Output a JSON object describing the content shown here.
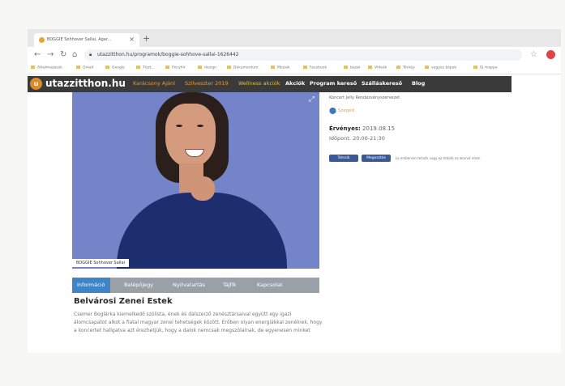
{
  "browser": {
    "tab_title": "BOGGIE Sohhover Sallai, Agar...",
    "tab_close": "×",
    "new_tab": "+",
    "url": "utazzitthon.hu/programok/boggie-sohhove-sallai-1626442",
    "bookmarks": [
      "Alkalmazások",
      "Gmail",
      "Google",
      "Tiszt...",
      "Fényhír",
      "design",
      "Dokumentum",
      "Mozaik",
      "Facebook",
      "bazár",
      "Videók",
      "Térkép",
      "vegyes képek",
      "Új mappa"
    ]
  },
  "site": {
    "logo_text": "utazzitthon.hu",
    "nav": [
      "Karácsony Ajánl",
      "Szilveszter 2019",
      "Wellness akciók",
      "Akciók",
      "Program kereső",
      "Szálláskereső",
      "Blog"
    ]
  },
  "hero": {
    "caption": "BOGGIE Sohhover Sallai"
  },
  "side": {
    "breadcrumbs": "Koncert    Jelly    Rendezvényszervezet",
    "location": "Szeged",
    "valid_label": "Érvényes:",
    "valid_value": "2019.08.15",
    "time_label": "Időpont:",
    "time_value": "20:00-21:30",
    "like_label": "Tetszik",
    "share_label": "Megosztás",
    "likes_text": "Lo embersen tetszik vagy ez tetszik ez akarvá nézni"
  },
  "tabs": [
    "Információ",
    "Belépőjegy",
    "Nyitvatartás",
    "Tájfík",
    "Kapcsolat"
  ],
  "content": {
    "title": "Belvárosi Zenei Estek",
    "paragraph": "Csemer Boglárka kiemelkedő szólista, ének és dalszerző zenésztársaival együtt egy igazi álomcsapatot alkot a fiatal magyar zenei tehetségek között. Erőben olyan energiákkal zenélnek, hogy a koncertet hallgatva azt érezhetjük, hogy a dalok nemcsak megszólalnak, de egyenesen minket"
  }
}
